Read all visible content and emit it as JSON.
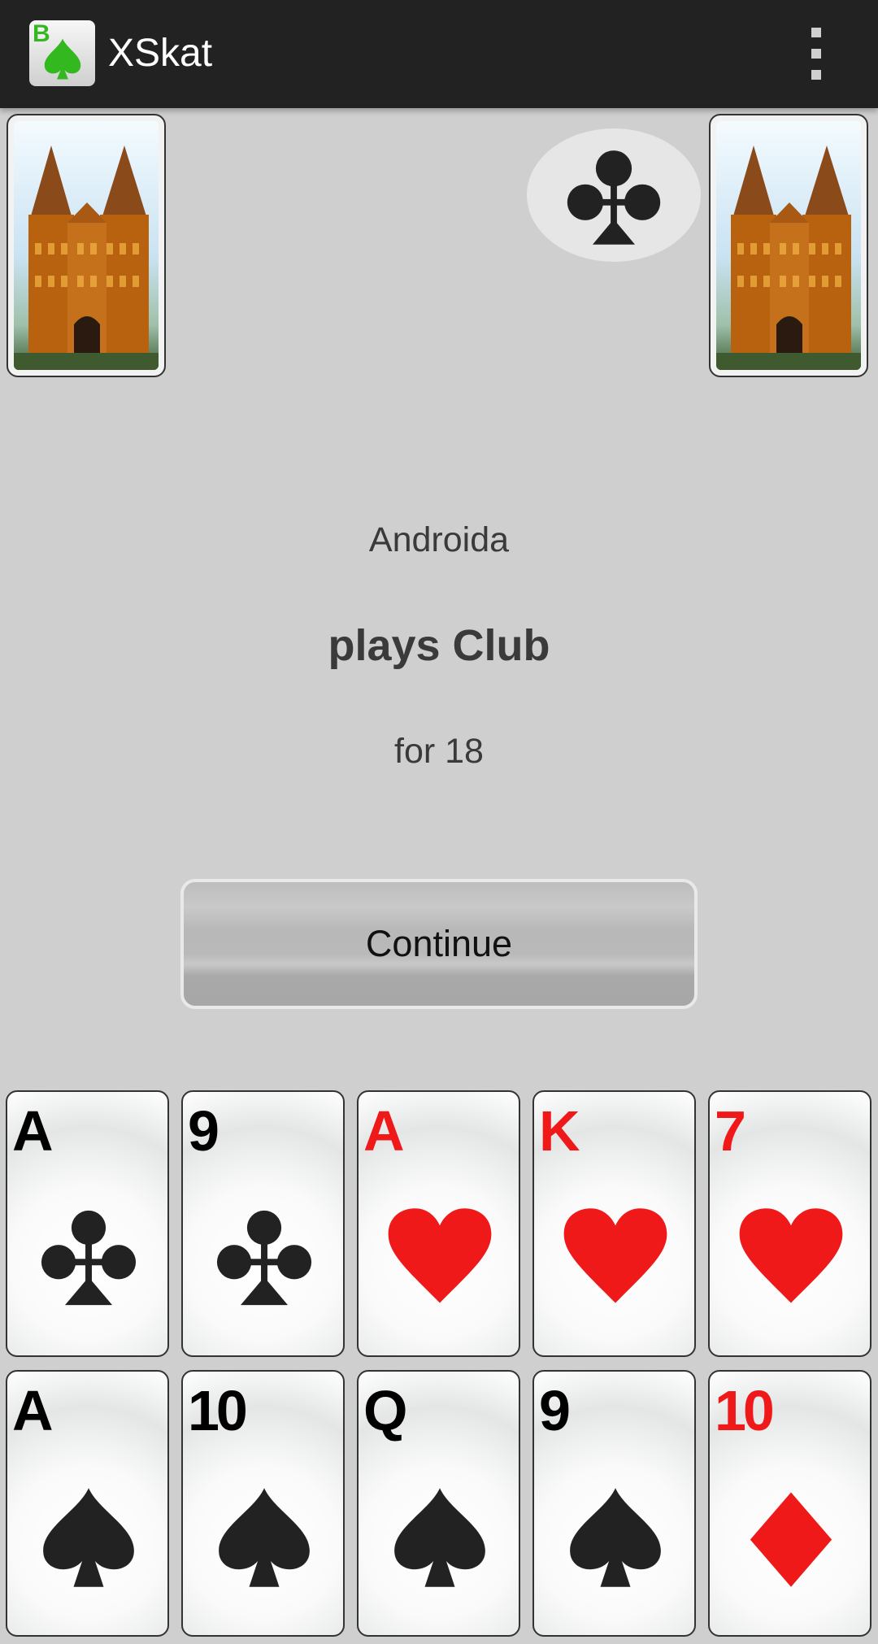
{
  "app_bar": {
    "title": "XSkat",
    "icon_name": "xskat-app-icon",
    "icon_letter": "B",
    "overflow_icon": "more-vert-icon"
  },
  "opponents": {
    "left_card": "card-back-holstentor",
    "right_card": "card-back-holstentor"
  },
  "trump_indicator": {
    "suit": "club"
  },
  "announcement": {
    "player": "Androida",
    "game": "plays Club",
    "bid": "for 18"
  },
  "continue_button": {
    "label": "Continue"
  },
  "hand": {
    "row1": [
      {
        "rank": "A",
        "suit": "club",
        "color": "black"
      },
      {
        "rank": "9",
        "suit": "club",
        "color": "black"
      },
      {
        "rank": "A",
        "suit": "heart",
        "color": "red"
      },
      {
        "rank": "K",
        "suit": "heart",
        "color": "red"
      },
      {
        "rank": "7",
        "suit": "heart",
        "color": "red"
      }
    ],
    "row2": [
      {
        "rank": "A",
        "suit": "spade",
        "color": "black"
      },
      {
        "rank": "10",
        "suit": "spade",
        "color": "black"
      },
      {
        "rank": "Q",
        "suit": "spade",
        "color": "black"
      },
      {
        "rank": "9",
        "suit": "spade",
        "color": "black"
      },
      {
        "rank": "10",
        "suit": "diamond",
        "color": "red"
      }
    ]
  },
  "colors": {
    "action_bar": "#222222",
    "table": "#cfcfcf",
    "red_suit": "#f01919",
    "black_suit": "#222222",
    "app_icon_green": "#33b81f"
  }
}
